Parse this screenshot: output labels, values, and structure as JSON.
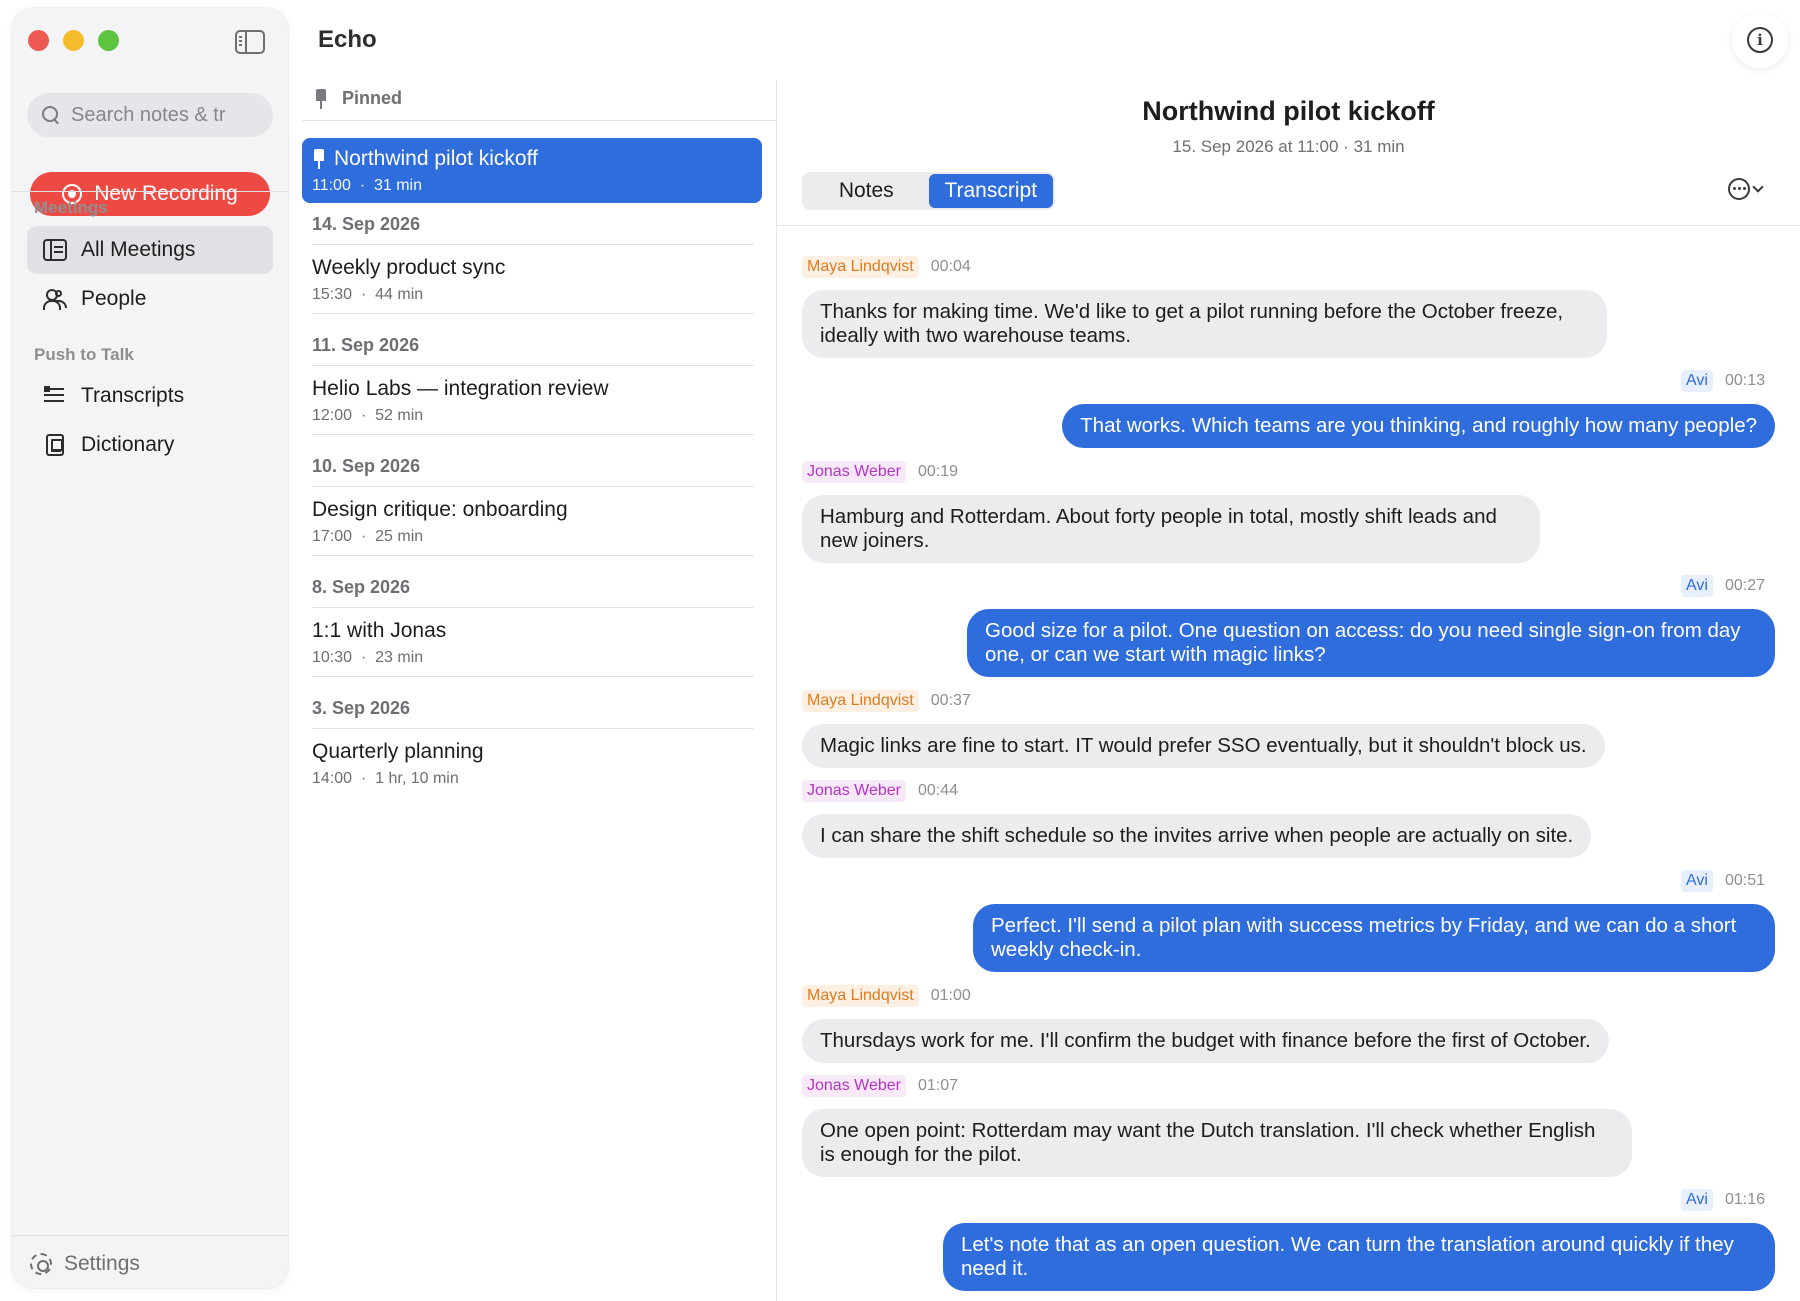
{
  "app": {
    "title": "Echo"
  },
  "sidebar": {
    "search_placeholder": "Search notes & tr",
    "new_recording_label": "New Recording",
    "meetings_section": "Meetings",
    "items": [
      {
        "label": "All Meetings",
        "icon": "list-icon",
        "active": true
      },
      {
        "label": "People",
        "icon": "people-icon"
      }
    ],
    "push_section": "Push to Talk",
    "push_items": [
      {
        "label": "Transcripts",
        "icon": "transcripts-icon"
      },
      {
        "label": "Dictionary",
        "icon": "dictionary-icon"
      }
    ],
    "settings_label": "Settings"
  },
  "list": {
    "pinned_label": "Pinned",
    "pinned": {
      "title": "Northwind pilot kickoff",
      "time": "11:00",
      "duration": "31 min"
    },
    "groups": [
      {
        "date": "14. Sep 2026",
        "title": "Weekly product sync",
        "time": "15:30",
        "duration": "44 min"
      },
      {
        "date": "11. Sep 2026",
        "title": "Helio Labs — integration review",
        "time": "12:00",
        "duration": "52 min"
      },
      {
        "date": "10. Sep 2026",
        "title": "Design critique: onboarding",
        "time": "17:00",
        "duration": "25 min"
      },
      {
        "date": "8. Sep 2026",
        "title": "1:1 with Jonas",
        "time": "10:30",
        "duration": "23 min"
      },
      {
        "date": "3. Sep 2026",
        "title": "Quarterly planning",
        "time": "14:00",
        "duration": "1 hr, 10 min"
      }
    ],
    "meta_separator": "·"
  },
  "detail": {
    "title": "Northwind pilot kickoff",
    "subtitle": "15. Sep 2026 at 11:00 · 31 min",
    "tabs": {
      "notes": "Notes",
      "transcript": "Transcript"
    },
    "messages": [
      {
        "speaker": "Maya Lindqvist",
        "time": "00:04",
        "side": "left",
        "text": "Thanks for making time. We'd like to get a pilot running before the October freeze, ideally with two warehouse teams."
      },
      {
        "speaker": "Avi",
        "time": "00:13",
        "side": "right",
        "text": "That works. Which teams are you thinking, and roughly how many people?"
      },
      {
        "speaker": "Jonas Weber",
        "time": "00:19",
        "side": "left",
        "text": "Hamburg and Rotterdam. About forty people in total, mostly shift leads and new joiners."
      },
      {
        "speaker": "Avi",
        "time": "00:27",
        "side": "right",
        "text": "Good size for a pilot. One question on access: do you need single sign-on from day one, or can we start with magic links?"
      },
      {
        "speaker": "Maya Lindqvist",
        "time": "00:37",
        "side": "left",
        "text": "Magic links are fine to start. IT would prefer SSO eventually, but it shouldn't block us."
      },
      {
        "speaker": "Jonas Weber",
        "time": "00:44",
        "side": "left",
        "text": "I can share the shift schedule so the invites arrive when people are actually on site."
      },
      {
        "speaker": "Avi",
        "time": "00:51",
        "side": "right",
        "text": "Perfect. I'll send a pilot plan with success metrics by Friday, and we can do a short weekly check-in."
      },
      {
        "speaker": "Maya Lindqvist",
        "time": "01:00",
        "side": "left",
        "text": "Thursdays work for me. I'll confirm the budget with finance before the first of October."
      },
      {
        "speaker": "Jonas Weber",
        "time": "01:07",
        "side": "left",
        "text": "One open point: Rotterdam may want the Dutch translation. I'll check whether English is enough for the pilot."
      },
      {
        "speaker": "Avi",
        "time": "01:16",
        "side": "right",
        "text": "Let's note that as an open question. We can turn the translation around quickly if they need it."
      }
    ]
  },
  "colors": {
    "accent": "#2f6cdc",
    "record": "#ee4a44",
    "maya": "#e07a1f",
    "jonas": "#b534c7",
    "avi": "#2f6cdc"
  }
}
